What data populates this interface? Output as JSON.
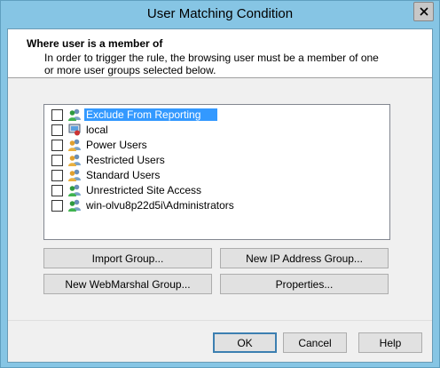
{
  "window": {
    "title": "User Matching Condition"
  },
  "header": {
    "title": "Where user is a member of",
    "description": "In order to trigger the rule, the browsing user must be a member of one or more user groups selected below."
  },
  "groups": [
    {
      "label": "Exclude From Reporting",
      "checked": false,
      "selected": true
    },
    {
      "label": "local",
      "checked": false,
      "selected": false
    },
    {
      "label": "Power Users",
      "checked": false,
      "selected": false
    },
    {
      "label": "Restricted Users",
      "checked": false,
      "selected": false
    },
    {
      "label": "Standard Users",
      "checked": false,
      "selected": false
    },
    {
      "label": "Unrestricted Site Access",
      "checked": false,
      "selected": false
    },
    {
      "label": "win-olvu8p22d5i\\Administrators",
      "checked": false,
      "selected": false
    }
  ],
  "buttons": {
    "import_group": "Import Group...",
    "new_ip_group": "New IP Address Group...",
    "new_webmarshal_group": "New WebMarshal Group...",
    "properties": "Properties...",
    "ok": "OK",
    "cancel": "Cancel",
    "help": "Help"
  },
  "colors": {
    "titlebar": "#86c5e4",
    "selection": "#3399ff",
    "close_x": "#000000"
  }
}
